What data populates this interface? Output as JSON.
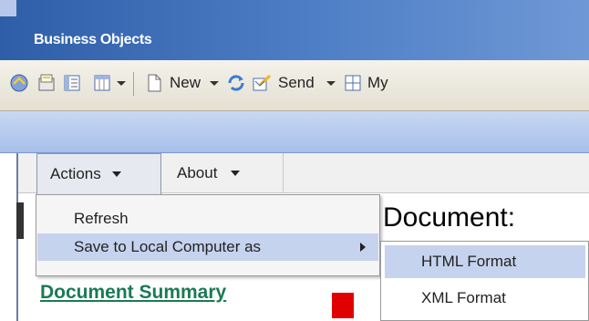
{
  "app": {
    "brand": "Business Objects"
  },
  "toolbar": {
    "new_label": "New",
    "send_label": "Send",
    "my_label": "My"
  },
  "menubar": {
    "actions_label": "Actions",
    "about_label": "About"
  },
  "actions_menu": {
    "items": [
      {
        "label": "Refresh"
      },
      {
        "label": "Save to Local Computer as",
        "has_submenu": true,
        "highlighted": true
      }
    ]
  },
  "save_submenu": {
    "items": [
      {
        "label": "HTML Format",
        "highlighted": true
      },
      {
        "label": "XML Format"
      }
    ]
  },
  "document": {
    "heading": "Document:",
    "summary_link": "Document Summary"
  },
  "colors": {
    "banner_blue": "#2f5ea8",
    "highlight": "#c6d3ee",
    "summary_link": "#1a7a55",
    "marker_red": "#e00000"
  }
}
